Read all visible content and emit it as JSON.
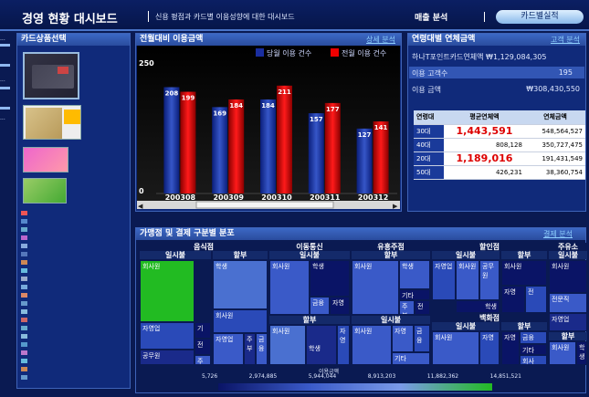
{
  "header": {
    "title": "경영 현황 대시보드",
    "subtitle": "신용 평점과 카드별 이용성향에 대한 대시보드",
    "tab_sales": "매출 분석",
    "tab_card": "카드별실적"
  },
  "left": {
    "title": "카드상품선택"
  },
  "mid": {
    "title": "전월대비 이용금액",
    "link": "상세 분석",
    "legend": [
      "당월 이용 건수",
      "전월 이용 건수"
    ]
  },
  "chart_data": {
    "type": "bar",
    "categories": [
      "200308",
      "200309",
      "200310",
      "200311",
      "200312"
    ],
    "series": [
      {
        "name": "당월 이용 건수",
        "values": [
          208,
          169,
          184,
          157,
          127
        ]
      },
      {
        "name": "전월 이용 건수",
        "values": [
          199,
          184,
          211,
          177,
          141
        ]
      }
    ],
    "ylim": [
      0,
      250
    ],
    "yticks": [
      "0",
      "250"
    ]
  },
  "right": {
    "title": "연령대별 연체금액",
    "link": "고객 분석",
    "card_line": "하나T포인트카드연체액  ₩1,129,084,305",
    "row1_label": "이용 고객수",
    "row1_value": "195",
    "row2_label": "이용  금액",
    "row2_value": "₩308,430,550",
    "table": {
      "headers": [
        "연령대",
        "평균연체액",
        "연체금액"
      ],
      "rows": [
        [
          "30대",
          "1,443,591",
          "548,564,527"
        ],
        [
          "40대",
          "808,128",
          "350,727,475"
        ],
        [
          "20대",
          "1,189,016",
          "191,431,549"
        ],
        [
          "50대",
          "426,231",
          "38,360,754"
        ]
      ]
    }
  },
  "bottom": {
    "title": "가맹점 및 결제 구분별 분포",
    "link": "결제 분석",
    "groups": [
      "음식점",
      "이동통신",
      "유흥주점",
      "할인점",
      "주유소",
      "백화점"
    ],
    "subs": {
      "ilsi": "일시불",
      "halbu": "할부"
    },
    "labels": {
      "hoesa": "회사원",
      "haksaeng": "학생",
      "jayeong": "자영업",
      "gi": "기",
      "jeon": "전",
      "ju": "주",
      "gongmu": "공무원",
      "geumyung": "금융",
      "jaeyeong": "자영",
      "gita": "기타",
      "jubu": "주부",
      "jeonmun": "전문직",
      "hoesa2": "회사"
    },
    "scale": {
      "title": "이용금액",
      "ticks": [
        "5,726",
        "2,974,885",
        "5,944,044",
        "8,913,203",
        "11,882,362",
        "14,851,521"
      ]
    }
  }
}
